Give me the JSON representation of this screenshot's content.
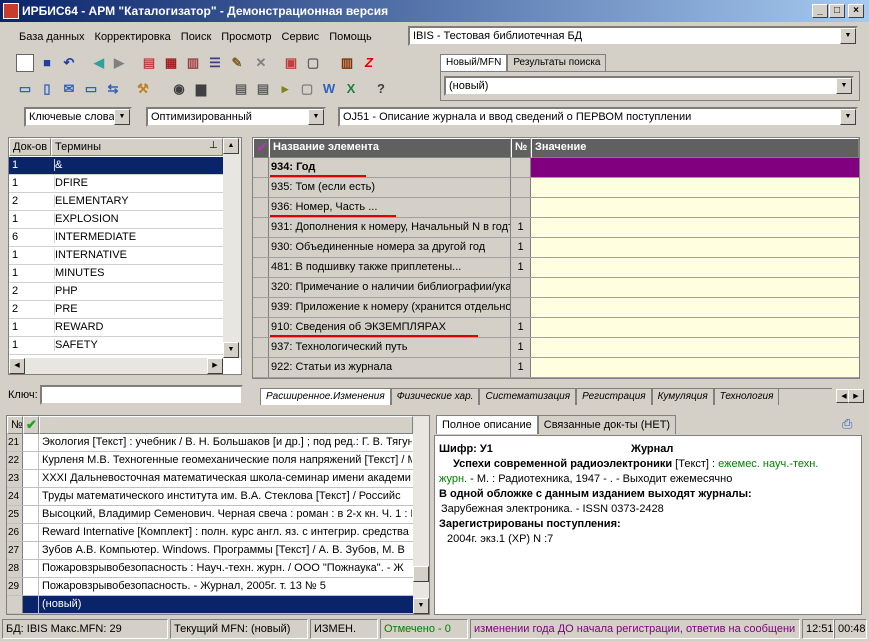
{
  "window": {
    "title": "ИРБИС64 - АРМ \"Каталогизатор\" - Демонстрационная версия"
  },
  "menu": [
    "База данных",
    "Корректировка",
    "Поиск",
    "Просмотр",
    "Сервис",
    "Помощь"
  ],
  "db_select": "IBIS - Тестовая библиотечная БД",
  "right_tabs": [
    "Новый/MFN",
    "Результаты поиска"
  ],
  "new_record_select": "(новый)",
  "search": {
    "mode": "Ключевые слова",
    "method": "Оптимизированный",
    "worksheet": "OJ51 - Описание журнала и ввод сведений о ПЕРВОМ поступлении"
  },
  "dictionary": {
    "col_docs": "Док-ов",
    "col_terms": "Термины",
    "key_label": "Ключ:",
    "rows": [
      {
        "count": "1",
        "term": "&"
      },
      {
        "count": "1",
        "term": "DFIRE"
      },
      {
        "count": "2",
        "term": "ELEMENTARY"
      },
      {
        "count": "1",
        "term": "EXPLOSION"
      },
      {
        "count": "6",
        "term": "INTERMEDIATE"
      },
      {
        "count": "1",
        "term": "INTERNATIVE"
      },
      {
        "count": "1",
        "term": "MINUTES"
      },
      {
        "count": "2",
        "term": "PHP"
      },
      {
        "count": "2",
        "term": "PRE"
      },
      {
        "count": "1",
        "term": "REWARD"
      },
      {
        "count": "1",
        "term": "SAFETY"
      }
    ]
  },
  "fields": {
    "col_name": "Название элемента",
    "col_num": "№",
    "col_value": "Значение",
    "rows": [
      {
        "name": "934: Год",
        "num": ""
      },
      {
        "name": "935: Том (если есть)",
        "num": ""
      },
      {
        "name": "936: Номер, Часть ...",
        "num": ""
      },
      {
        "name": "931: Дополнения к номеру, Начальный N в годт",
        "num": "1"
      },
      {
        "name": "930: Объединенные номера за другой год",
        "num": "1"
      },
      {
        "name": "481: В подшивку также приплетены...",
        "num": "1"
      },
      {
        "name": "320: Примечание о наличии библиографии/указ",
        "num": ""
      },
      {
        "name": "939: Приложение к номеру (хранится отдельно",
        "num": ""
      },
      {
        "name": "910: Сведения  об ЭКЗЕМПЛЯРАХ",
        "num": "1"
      },
      {
        "name": "937: Технологический путь",
        "num": "1"
      },
      {
        "name": "922: Статьи из журнала",
        "num": "1"
      }
    ]
  },
  "worksheet_tabs": [
    "Расширенное.Изменения",
    "Физические хар.",
    "Систематизация",
    "Регистрация",
    "Кумуляция",
    "Технология"
  ],
  "records": {
    "col_num": "№",
    "rows": [
      {
        "n": "21",
        "text": "Экология [Текст] : учебник / В. Н. Большаков [и др.] ; под ред.: Г. В. Тягун"
      },
      {
        "n": "22",
        "text": "Курленя М.В. Техногенные геомеханические поля напряжений [Текст] / М"
      },
      {
        "n": "23",
        "text": "XXXI Дальневосточная математическая школа-семинар имени академи"
      },
      {
        "n": "24",
        "text": "Труды математического института им. В.А. Стеклова [Текст] / Российс"
      },
      {
        "n": "25",
        "text": "Высоцкий, Владимир Семенович. Черная свеча : роман : в 2-х кн. Ч. 1 : Р"
      },
      {
        "n": "26",
        "text": "Reward Internative [Комплект] : полн. курс англ. яз. с интегрир. средства"
      },
      {
        "n": "27",
        "text": "Зубов А.В. Компьютер. Windows. Программы [Текст] / А. В. Зубов, М. В"
      },
      {
        "n": "28",
        "text": "Пожаровзрывобезопасность : Науч.-техн. журн. / ООО \"Пожнаука\". - Ж"
      },
      {
        "n": "29",
        "text": "Пожаровзрывобезопасность. - Журнал, 2005г. т. 13 № 5"
      },
      {
        "n": "",
        "text": "(новый)"
      }
    ]
  },
  "desc_tabs": [
    "Полное описание",
    "Связанные док-ты (НЕТ)"
  ],
  "description": {
    "shifr": "Шифр: У1",
    "type": "Журнал",
    "title_bold": "Успехи современной радиоэлектроники",
    "title_rest": " [Текст] : ",
    "green1": "ежемес. науч.-техн.",
    "green2": "журн.",
    "pub": " - М. : Радиотехника, 1947 - . - Выходит ежемесячно",
    "together_head": "В одной обложке с данным изданием выходят журналы:",
    "together": "Зарубежная электроника. - ISSN 0373-2428",
    "reg_head": "Зарегистрированы поступления:",
    "reg": "2004г. экз.1 (ХР) N :7"
  },
  "status": {
    "db": "БД: IBIS Макс.MFN: 29",
    "mfn": "Текущий MFN: (новый)",
    "changed": "ИЗМЕН.",
    "marked": "Отмечено - 0",
    "hint": "изменении года ДО начала регистрации, ответив на сообщени",
    "time1": "12:51",
    "time2": "00:48"
  },
  "colors": {
    "title_start": "#0a246a",
    "selection": "#0a246a",
    "purple": "#800080",
    "value_bg": "#ffffe0",
    "status_green": "#008000",
    "status_purple": "#800080",
    "underline": "#e00000"
  }
}
